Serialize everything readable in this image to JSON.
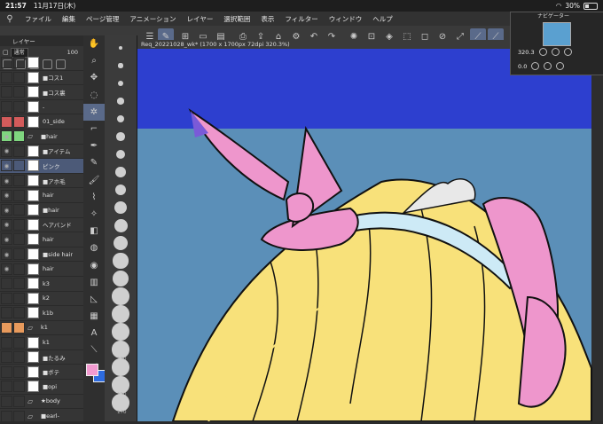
{
  "status": {
    "time": "21:57",
    "date": "11月17日(木)",
    "battery": "30%"
  },
  "menu": {
    "items": [
      "ファイル",
      "編集",
      "ページ管理",
      "アニメーション",
      "レイヤー",
      "選択範囲",
      "表示",
      "フィルター",
      "ウィンドウ",
      "ヘルプ"
    ]
  },
  "layer_panel": {
    "title": "レイヤー",
    "blend_mode": "通常",
    "opacity": "100"
  },
  "layers": [
    {
      "name": "",
      "type": "layer",
      "eye": "",
      "lock": ""
    },
    {
      "name": "■コス1",
      "type": "layer",
      "eye": "",
      "lock": ""
    },
    {
      "name": "■コス裏",
      "type": "layer",
      "eye": "",
      "lock": ""
    },
    {
      "name": "-",
      "type": "layer",
      "eye": "",
      "lock": ""
    },
    {
      "name": "01_side",
      "type": "layer",
      "eye": "",
      "lock": "",
      "red": true
    },
    {
      "name": "■hair",
      "type": "folder",
      "eye": "◉",
      "lock": "",
      "green": true
    },
    {
      "name": "■アイテム",
      "type": "layer",
      "eye": "◉",
      "lock": ""
    },
    {
      "name": "ピンク",
      "type": "layer",
      "eye": "◉",
      "lock": "",
      "selected": true
    },
    {
      "name": "■アホ毛",
      "type": "layer",
      "eye": "◉",
      "lock": ""
    },
    {
      "name": "hair",
      "type": "layer",
      "eye": "◉",
      "lock": ""
    },
    {
      "name": "■hair",
      "type": "layer",
      "eye": "◉",
      "lock": ""
    },
    {
      "name": "ヘアバンド",
      "type": "layer",
      "eye": "◉",
      "lock": ""
    },
    {
      "name": "hair",
      "type": "layer",
      "eye": "◉",
      "lock": ""
    },
    {
      "name": "■side hair",
      "type": "layer",
      "eye": "◉",
      "lock": ""
    },
    {
      "name": "hair",
      "type": "layer",
      "eye": "◉",
      "lock": ""
    },
    {
      "name": "k3",
      "type": "layer",
      "eye": "",
      "lock": ""
    },
    {
      "name": "k2",
      "type": "layer",
      "eye": "",
      "lock": ""
    },
    {
      "name": "k1b",
      "type": "layer",
      "eye": "",
      "lock": ""
    },
    {
      "name": "k1",
      "type": "folder",
      "eye": "",
      "lock": "",
      "orange": true
    },
    {
      "name": "k1",
      "type": "layer",
      "eye": "",
      "lock": ""
    },
    {
      "name": "■たるみ",
      "type": "layer",
      "eye": "",
      "lock": ""
    },
    {
      "name": "■ボテ",
      "type": "layer",
      "eye": "",
      "lock": ""
    },
    {
      "name": "■opi",
      "type": "layer",
      "eye": "",
      "lock": ""
    },
    {
      "name": "★body",
      "type": "folder",
      "eye": "",
      "lock": ""
    },
    {
      "name": "■earl-",
      "type": "folder",
      "eye": "",
      "lock": ""
    }
  ],
  "doc_tab": {
    "label": "Req_20221028_wk* (1700 x 1700px 72dpi 320.3%)"
  },
  "navigator": {
    "title": "ナビゲーター",
    "zoom": "320.3",
    "rotation": "0.0"
  },
  "brush_sizes": [
    "",
    "",
    "",
    "",
    "",
    "",
    "",
    "",
    "",
    "",
    "",
    "",
    "",
    "",
    "",
    "",
    "",
    "100",
    "",
    "150",
    "170"
  ],
  "colors": {
    "fg": "#f29ad0",
    "bg": "#2d6be0"
  }
}
